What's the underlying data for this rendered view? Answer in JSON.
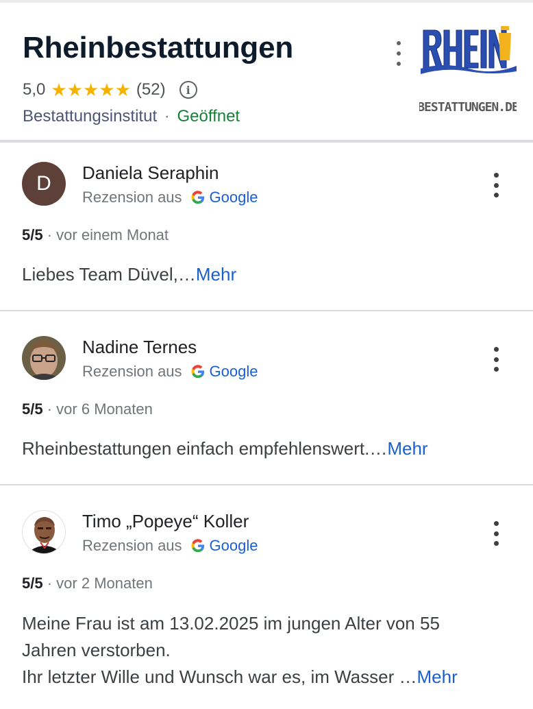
{
  "business": {
    "name": "Rheinbestattungen",
    "rating": "5,0",
    "stars": "★★★★★",
    "review_count": "(52)",
    "info_icon": "info-icon",
    "category": "Bestattungsinstitut",
    "separator": "·",
    "status": "Geöffnet",
    "logo_text_top": "RHEIN",
    "logo_text_bottom": "BESTATTUNGEN.DE"
  },
  "reviews": [
    {
      "name": "Daniela Seraphin",
      "avatar_letter": "D",
      "source_label": "Rezension aus",
      "source_name": "Google",
      "score": "5/5",
      "time": "vor einem Monat",
      "text": "Liebes Team Düvel,…",
      "more": "Mehr"
    },
    {
      "name": "Nadine Ternes",
      "source_label": "Rezension aus",
      "source_name": "Google",
      "score": "5/5",
      "time": "vor 6 Monaten",
      "text": "Rheinbestattungen einfach empfehlenswert.…",
      "more": "Mehr"
    },
    {
      "name": "Timo „Popeye“ Koller",
      "source_label": "Rezension aus",
      "source_name": "Google",
      "score": "5/5",
      "time": "vor 2 Monaten",
      "text_line1": "Meine Frau ist am 13.02.2025 im jungen Alter von 55",
      "text_line2": "Jahren verstorben.",
      "text_line3": "Ihr letzter Wille und Wunsch war es, im Wasser …",
      "more": "Mehr"
    }
  ],
  "colors": {
    "stars": "#f5b300",
    "open": "#188038",
    "link": "#1a5fd0",
    "logo_blue": "#2a4fb0",
    "logo_yellow": "#f2b21c"
  }
}
